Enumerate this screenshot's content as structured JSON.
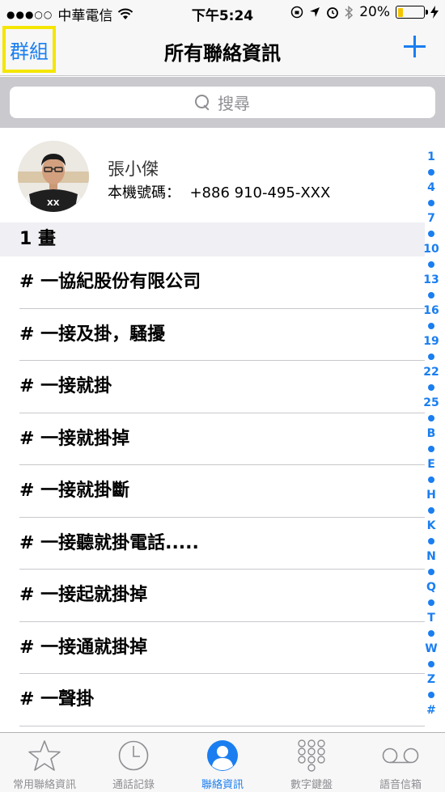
{
  "status": {
    "carrier": "中華電信",
    "time": "下午5:24",
    "battery": "20%",
    "battery_level": 0.2
  },
  "nav": {
    "groups_label": "群組",
    "title": "所有聯絡資訊",
    "add_icon": "plus-icon"
  },
  "search": {
    "placeholder": "搜尋"
  },
  "my_card": {
    "name": "張小傑",
    "phone_label": "本機號碼：",
    "phone": "+886 910-495-XXX"
  },
  "section_header": "1 畫",
  "contacts": [
    "# 一協紀股份有限公司",
    "# 一接及掛，騷擾",
    "# 一接就掛",
    "# 一接就掛掉",
    "# 一接就掛斷",
    "# 一接聽就掛電話.....",
    "# 一接起就掛掉",
    "# 一接通就掛掉",
    "# 一聲掛"
  ],
  "index": [
    "1",
    "4",
    "7",
    "10",
    "13",
    "16",
    "19",
    "22",
    "25",
    "B",
    "E",
    "H",
    "K",
    "N",
    "Q",
    "T",
    "W",
    "Z",
    "#"
  ],
  "tabs": [
    {
      "label": "常用聯絡資訊",
      "icon": "star-icon"
    },
    {
      "label": "通話記錄",
      "icon": "clock-icon"
    },
    {
      "label": "聯絡資訊",
      "icon": "person-icon"
    },
    {
      "label": "數字鍵盤",
      "icon": "keypad-icon"
    },
    {
      "label": "語音信箱",
      "icon": "voicemail-icon"
    }
  ],
  "colors": {
    "accent": "#1a7ef0",
    "highlight_box": "#f4e600",
    "battery": "#f5c400"
  }
}
